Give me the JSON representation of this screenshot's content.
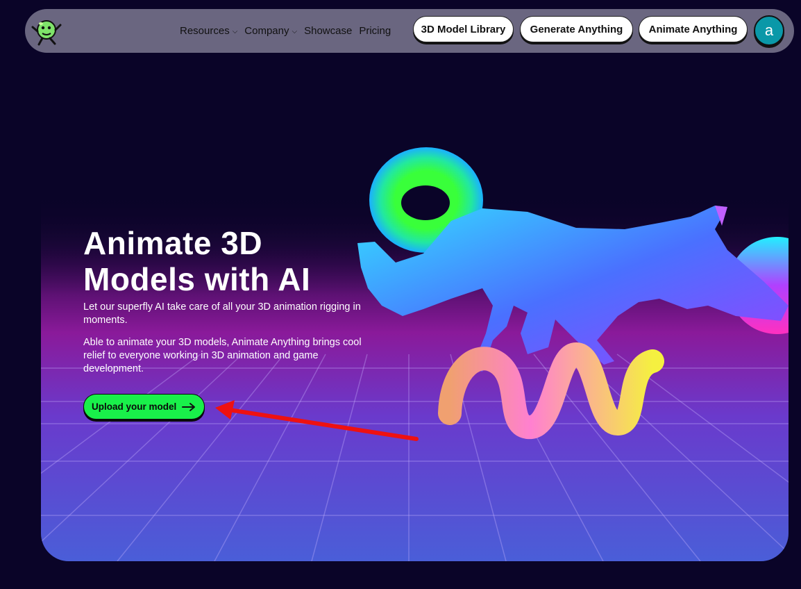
{
  "nav": {
    "links": [
      {
        "label": "Resources",
        "has_dropdown": true
      },
      {
        "label": "Company",
        "has_dropdown": true
      },
      {
        "label": "Showcase",
        "has_dropdown": false
      },
      {
        "label": "Pricing",
        "has_dropdown": false
      }
    ],
    "buttons": {
      "library": "3D Model Library",
      "generate": "Generate Anything",
      "animate": "Animate Anything"
    },
    "avatar_letter": "a"
  },
  "hero": {
    "title_line1": "Animate 3D",
    "title_line2": "Models with AI",
    "subtitle": "Let our superfly AI take care of all your 3D animation rigging in moments.",
    "description": "Able to animate your 3D models, Animate Anything brings cool relief to everyone working in 3D animation and game development.",
    "cta_label": "Upload your model"
  },
  "colors": {
    "background": "#0a0428",
    "nav_bg": "#6a6680",
    "cta": "#19f04a",
    "avatar": "#0a98a8",
    "annotation_arrow": "#ee1111"
  },
  "icons": {
    "logo": "running-planet-mascot",
    "cta_arrow": "arrow-right-icon",
    "dropdown": "chevron-down-icon"
  }
}
